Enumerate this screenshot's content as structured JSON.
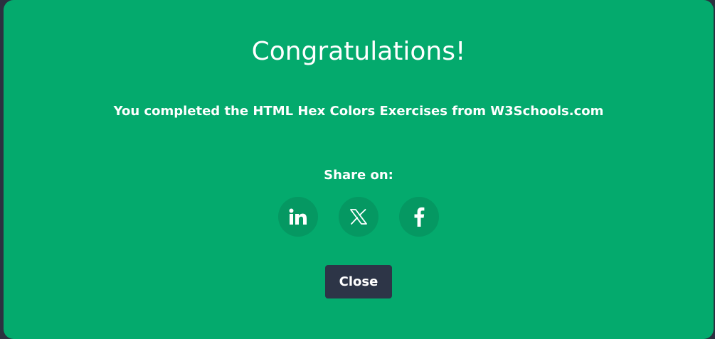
{
  "modal": {
    "title": "Congratulations!",
    "message": "You completed the HTML Hex Colors Exercises from W3Schools.com",
    "share_label": "Share on:",
    "share_buttons": [
      {
        "icon": "linkedin-icon"
      },
      {
        "icon": "x-icon"
      },
      {
        "icon": "facebook-icon"
      }
    ],
    "close_label": "Close"
  },
  "colors": {
    "modal_background": "#04aa6d",
    "share_button_background": "#059862",
    "close_button_background": "#2d3547",
    "page_background": "#2b3140",
    "text": "#ffffff"
  }
}
